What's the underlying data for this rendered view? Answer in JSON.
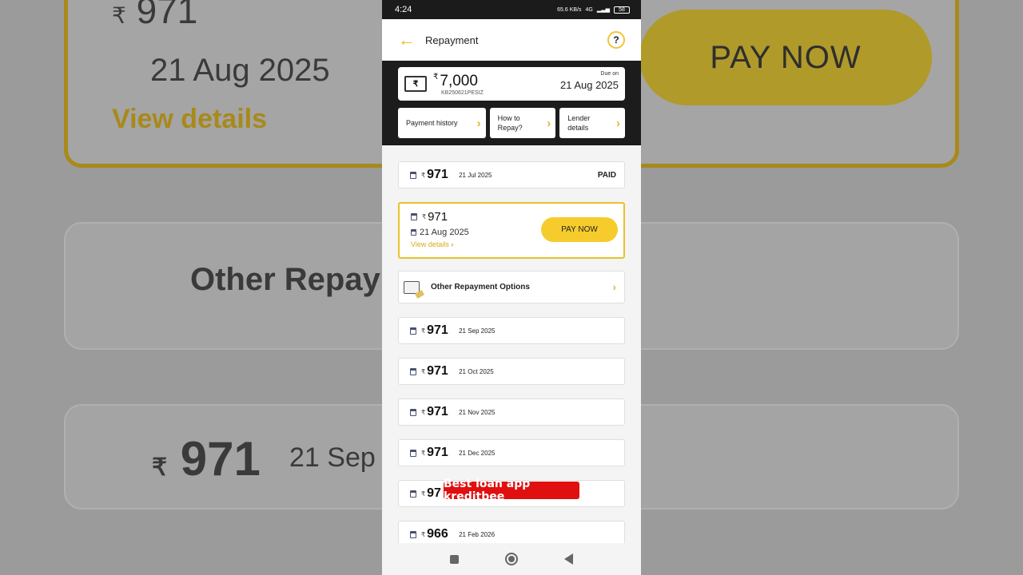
{
  "background": {
    "top_amount": "971",
    "rupee": "₹",
    "date": "21 Aug 2025",
    "view_details": "View details",
    "pay_now": "PAY NOW",
    "other_options": "Other Repay",
    "sep_amount": "971",
    "sep_date": "21 Sep"
  },
  "status_bar": {
    "time": "4:24",
    "speed": "65.6 KB/s",
    "network": "4G",
    "battery": "58"
  },
  "app_bar": {
    "title": "Repayment",
    "help": "?"
  },
  "loan": {
    "currency": "₹",
    "amount": "7,000",
    "loan_id": "KB250621PESIZ",
    "due_label": "Due on",
    "due_date": "21 Aug 2025"
  },
  "quick_actions": [
    {
      "label": "Payment history"
    },
    {
      "label": "How to Repay?"
    },
    {
      "label": "Lender details"
    }
  ],
  "paid_installment": {
    "amount": "971",
    "date": "21 Jul 2025",
    "status": "PAID"
  },
  "current_installment": {
    "amount": "971",
    "date": "21 Aug 2025",
    "view_details": "View details",
    "pay_button": "PAY NOW"
  },
  "other_options": {
    "label": "Other Repayment Options"
  },
  "upcoming": [
    {
      "amount": "971",
      "date": "21 Sep 2025"
    },
    {
      "amount": "971",
      "date": "21 Oct 2025"
    },
    {
      "amount": "971",
      "date": "21 Nov 2025"
    },
    {
      "amount": "971",
      "date": "21 Dec 2025"
    },
    {
      "amount": "97",
      "date": ""
    },
    {
      "amount": "966",
      "date": "21 Feb 2026"
    }
  ],
  "overlay_caption": "Best loan app kreditbee",
  "colors": {
    "accent": "#f6cc2d",
    "dark": "#1c1c1c",
    "overlay": "#e01010"
  }
}
